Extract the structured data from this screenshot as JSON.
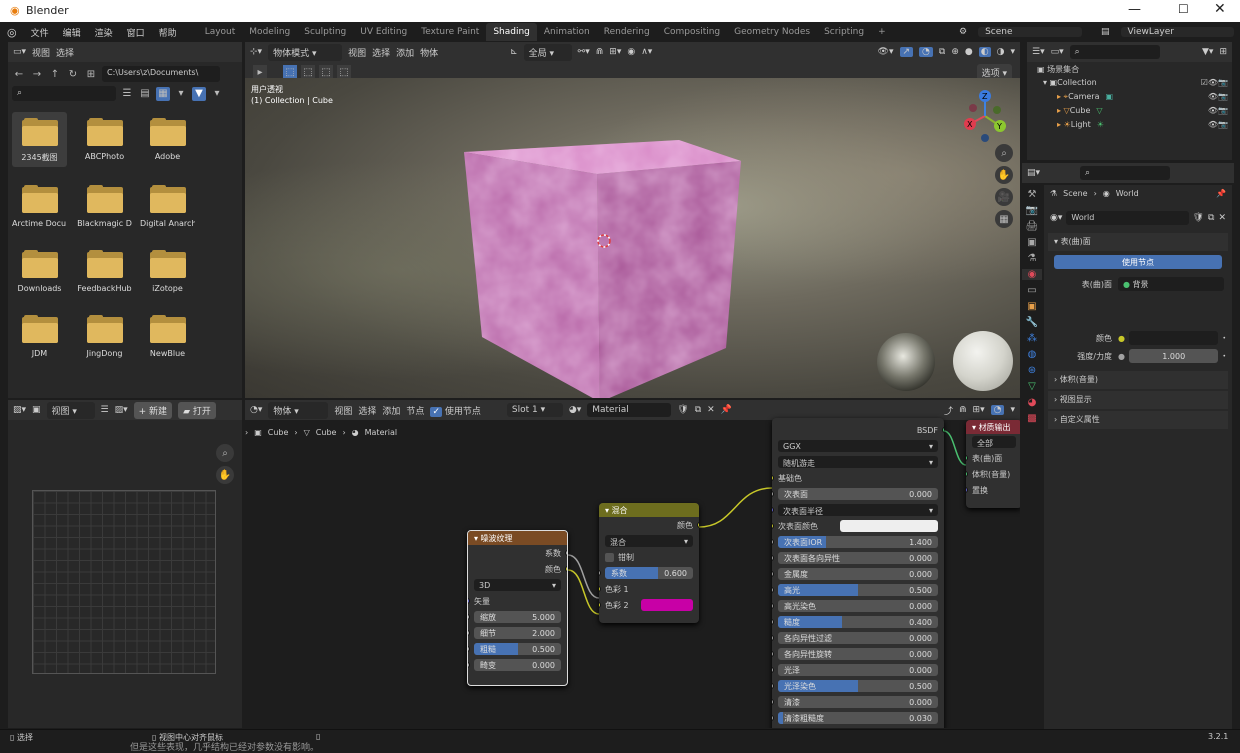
{
  "app": {
    "title": "Blender",
    "version": "3.2.1"
  },
  "menu": [
    "文件",
    "编辑",
    "渲染",
    "窗口",
    "帮助"
  ],
  "workspaces": [
    "Layout",
    "Modeling",
    "Sculpting",
    "UV Editing",
    "Texture Paint",
    "Shading",
    "Animation",
    "Rendering",
    "Compositing",
    "Geometry Nodes",
    "Scripting"
  ],
  "active_workspace": "Shading",
  "top_right": {
    "scene": "Scene",
    "view_layer": "ViewLayer"
  },
  "file_browser": {
    "menu": [
      "视图",
      "选择"
    ],
    "path": "C:\\Users\\z\\Documents\\",
    "folders": [
      "2345截图",
      "ABCPhoto",
      "Adobe",
      "Arctime Docu...",
      "Blackmagic D",
      "Digital Anarch",
      "Downloads",
      "FeedbackHub",
      "iZotope",
      "JDM",
      "JingDong",
      "NewBlue"
    ]
  },
  "viewport": {
    "mode": "物体模式",
    "menu": [
      "视图",
      "选择",
      "添加",
      "物体"
    ],
    "transform": "全局",
    "options": "选项",
    "overlay_title": "用户透视",
    "overlay_sub": "(1) Collection | Cube",
    "gizmo": {
      "x": "X",
      "y": "Y",
      "z": "Z"
    }
  },
  "outliner": {
    "root": "场景集合",
    "items": [
      {
        "name": "Collection"
      },
      {
        "name": "Camera"
      },
      {
        "name": "Cube"
      },
      {
        "name": "Light"
      }
    ]
  },
  "properties": {
    "breadcrumb": [
      "Scene",
      "World"
    ],
    "world_name": "World",
    "sections": [
      "表(曲)面",
      "体积(音量)",
      "视图显示",
      "自定义属性"
    ],
    "use_nodes": "使用节点",
    "surface_label": "表(曲)面",
    "surface_value": "背景",
    "color_label": "颜色",
    "strength_label": "强度/力度",
    "strength_value": "1.000"
  },
  "image_editor": {
    "view": "视图",
    "new": "+ 新建",
    "open": "打开"
  },
  "node_editor": {
    "mode": "物体",
    "menu": [
      "视图",
      "选择",
      "添加",
      "节点"
    ],
    "use_nodes": "使用节点",
    "slot": "Slot 1",
    "material": "Material",
    "breadcrumb": [
      "Cube",
      "Cube",
      "Material"
    ],
    "noise": {
      "title": "噪波纹理",
      "out_fac": "系数",
      "out_color": "颜色",
      "dim": "3D",
      "vector": "矢量",
      "inputs": [
        {
          "label": "缩放",
          "value": "5.000"
        },
        {
          "label": "细节",
          "value": "2.000"
        },
        {
          "label": "粗糙",
          "value": "0.500",
          "fill": 0.5
        },
        {
          "label": "畸变",
          "value": "0.000"
        }
      ]
    },
    "mix": {
      "title": "混合",
      "out": "颜色",
      "blend": "混合",
      "clamp": "钳制",
      "fac_label": "系数",
      "fac": "0.600",
      "fac_fill": 0.6,
      "color1": "色彩 1",
      "color2": "色彩 2",
      "color2_hex": "#c800a6"
    },
    "bsdf": {
      "out": "BSDF",
      "dist": "GGX",
      "sss": "随机游走",
      "base_color": "基础色",
      "rows": [
        {
          "label": "次表面",
          "value": "0.000"
        },
        {
          "label": "次表面半径",
          "value": "",
          "type": "drop"
        },
        {
          "label": "次表面颜色",
          "value": "",
          "type": "color"
        },
        {
          "label": "次表面IOR",
          "value": "1.400",
          "fill": 0.3
        },
        {
          "label": "次表面各向异性",
          "value": "0.000"
        },
        {
          "label": "金属度",
          "value": "0.000"
        },
        {
          "label": "高光",
          "value": "0.500",
          "fill": 0.5
        },
        {
          "label": "高光染色",
          "value": "0.000"
        },
        {
          "label": "糙度",
          "value": "0.400",
          "fill": 0.4
        },
        {
          "label": "各向异性过滤",
          "value": "0.000"
        },
        {
          "label": "各向异性旋转",
          "value": "0.000"
        },
        {
          "label": "光泽",
          "value": "0.000"
        },
        {
          "label": "光泽染色",
          "value": "0.500",
          "fill": 0.5
        },
        {
          "label": "清漆",
          "value": "0.000"
        },
        {
          "label": "清漆粗糙度",
          "value": "0.030",
          "fill": 0.03
        }
      ]
    },
    "output": {
      "title": "材质输出",
      "target": "全部",
      "surface": "表(曲)面",
      "volume": "体积(音量)",
      "disp": "置换"
    }
  },
  "status": {
    "left": "选择",
    "mid": "视图中心对齐鼠标",
    "behind": "但是这些表现，几乎结构已经对参数没有影响。"
  }
}
